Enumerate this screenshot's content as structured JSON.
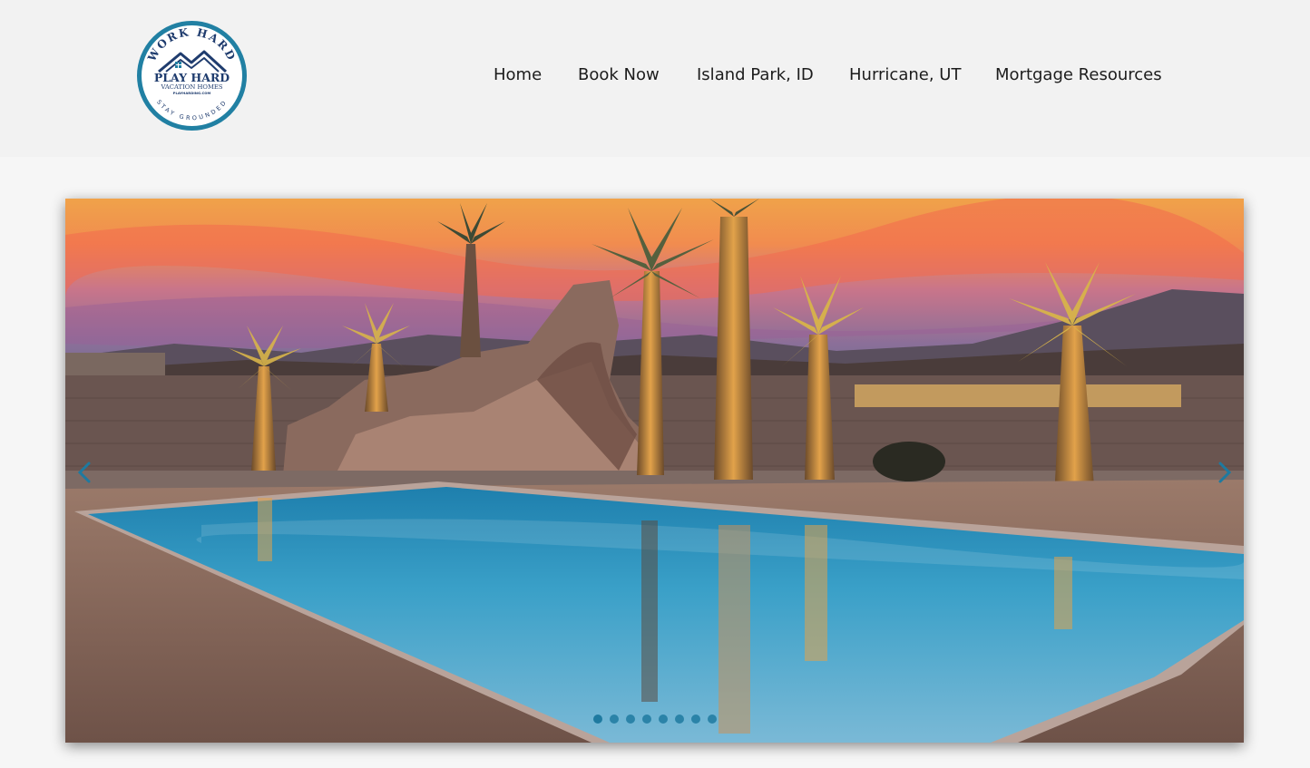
{
  "logo": {
    "ring_top_text": "WORK HARD",
    "ring_bottom_text": "STAY GROUNDED",
    "main_text": "PLAY HARD",
    "sub_text": "VACATION HOMES",
    "url_text": "PLAYHARDING.COM",
    "icon": "house-icon"
  },
  "nav": {
    "items": [
      {
        "label": "Home"
      },
      {
        "label": "Book Now"
      },
      {
        "label": "Island Park, ID"
      },
      {
        "label": "Hurricane, UT"
      },
      {
        "label": "Mortgage Resources"
      }
    ]
  },
  "slider": {
    "slide_count": 8,
    "active_index": 0,
    "prev_icon": "chevron-left-icon",
    "next_icon": "chevron-right-icon"
  },
  "colors": {
    "accent": "#1e7aa0",
    "logo_ring": "#2180a3",
    "logo_text": "#1f3c6e",
    "nav_text": "#1c1c1c",
    "header_bg": "#f2f2f2",
    "page_bg": "#f6f6f6"
  }
}
